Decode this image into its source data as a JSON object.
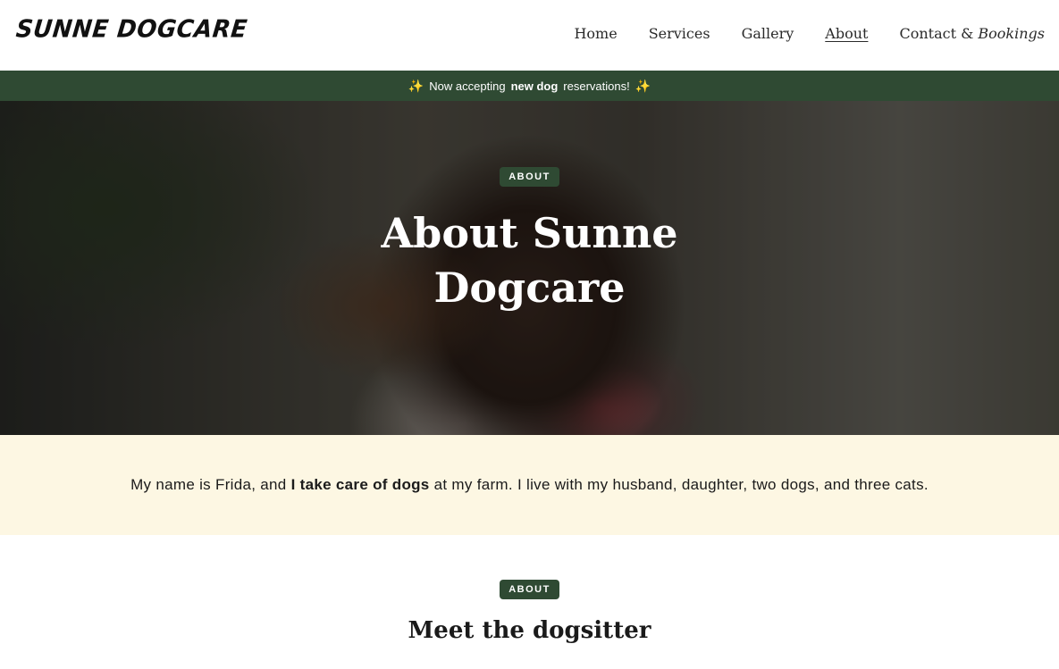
{
  "header": {
    "logo": "SUNNE DOGCARE",
    "nav": [
      {
        "label": "Home"
      },
      {
        "label": "Services"
      },
      {
        "label": "Gallery"
      },
      {
        "label": "About"
      },
      {
        "label_plain": "Contact & ",
        "label_em": "Bookings"
      }
    ],
    "active_nav": "About"
  },
  "announcement": {
    "icon": "sparkle-icon",
    "prefix": "Now accepting",
    "bold": "new dog",
    "suffix": "reservations!"
  },
  "hero": {
    "badge": "ABOUT",
    "title": "About Sunne Dogcare"
  },
  "intro": {
    "prefix": "My name is Frida, and",
    "bold": "I take care of dogs",
    "suffix": "at my farm. I live with my husband, daughter, two dogs, and three cats."
  },
  "meet": {
    "badge": "ABOUT",
    "title": "Meet the dogsitter"
  },
  "colors": {
    "brand_green": "#2f4a33",
    "cream": "#fdf7e3",
    "sparkle": "#f3c64b"
  }
}
